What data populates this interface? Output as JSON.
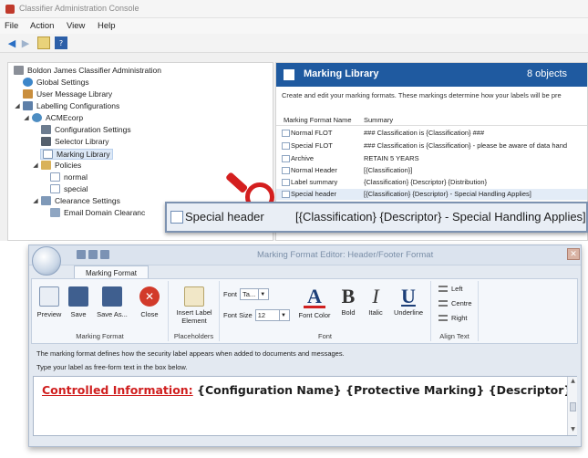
{
  "window": {
    "title": "Classifier Administration Console"
  },
  "menu": [
    "File",
    "Action",
    "View",
    "Help"
  ],
  "toolbar": {
    "icons": [
      "back-arrow-icon",
      "forward-arrow-icon",
      "up-folder-icon",
      "help-icon"
    ]
  },
  "tree": {
    "items": [
      {
        "label": "Boldon James Classifier Administration",
        "icon": "admin-icon"
      },
      {
        "label": "Global Settings",
        "icon": "globe-icon"
      },
      {
        "label": "User Message Library",
        "icon": "users-icon"
      },
      {
        "label": "Labelling Configurations",
        "icon": "config-icon"
      },
      {
        "label": "ACMEcorp",
        "icon": "org-icon"
      },
      {
        "label": "Configuration Settings",
        "icon": "settings-icon"
      },
      {
        "label": "Selector Library",
        "icon": "selector-icon"
      },
      {
        "label": "Marking Library",
        "icon": "marking-icon"
      },
      {
        "label": "Policies",
        "icon": "policies-icon"
      },
      {
        "label": "normal",
        "icon": "policy-icon"
      },
      {
        "label": "special",
        "icon": "policy-icon"
      },
      {
        "label": "Clearance Settings",
        "icon": "clearance-icon"
      },
      {
        "label": "Email Domain Clearanc",
        "icon": "email-domain-icon"
      }
    ]
  },
  "library": {
    "title": "Marking Library",
    "count": "8 objects",
    "description": "Create and edit your marking formats.  These markings determine how your labels will be pre",
    "columns": [
      "Marking Format Name",
      "Summary"
    ],
    "rows": [
      {
        "name": "Normal FLOT",
        "summary": "### Classification is {Classification} ###"
      },
      {
        "name": "Special FLOT",
        "summary": "### Classification is {Classification} - please be aware of data hand"
      },
      {
        "name": "Archive",
        "summary": "RETAIN 5 YEARS"
      },
      {
        "name": "Normal Header",
        "summary": "[{Classification}]"
      },
      {
        "name": "Label summary",
        "summary": "{Classification} {Descriptor} {Distribution}"
      },
      {
        "name": "Special header",
        "summary": "[{Classification} {Descriptor} - Special Handling Applies]"
      }
    ]
  },
  "zoom": {
    "name": "Special header",
    "summary": "[{Classification} {Descriptor} - Special Handling Applies]"
  },
  "editor": {
    "title": "Marking Format Editor: Header/Footer Format",
    "tab": "Marking Format",
    "groups": {
      "marking_format": "Marking Format",
      "placeholders": "Placeholders",
      "font": "Font",
      "align": "Align Text"
    },
    "buttons": {
      "preview": "Preview",
      "save": "Save",
      "save_as": "Save As...",
      "close": "Close",
      "insert_label": "Insert Label",
      "insert_label_2": "Element",
      "font_color": "Font Color",
      "bold": "Bold",
      "italic": "Italic",
      "underline": "Underline",
      "left": "Left",
      "centre": "Centre",
      "right": "Right"
    },
    "font": {
      "label": "Font",
      "value": "Ta...",
      "size_label": "Font Size",
      "size_value": "12"
    },
    "instructions": [
      "The marking format defines how the security label appears when added to documents and messages.",
      "Type your label as free-form text in the box below."
    ],
    "text": {
      "red": "Controlled Information:",
      "rest": " {Configuration Name} {Protective Marking} {Descriptor}"
    }
  },
  "colors": {
    "header_blue": "#1f5aa0",
    "magnifier_red": "#d41f1f",
    "label_red": "#d02020"
  }
}
